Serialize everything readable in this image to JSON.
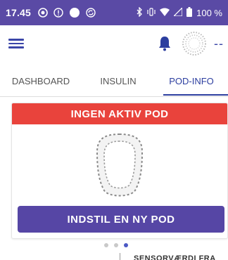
{
  "status_bar": {
    "time": "17.45",
    "battery_label": "100 %",
    "icons": [
      "circle-dot-icon",
      "info-circle-icon",
      "solid-circle-icon",
      "sync-icon",
      "bluetooth-icon",
      "vibrate-icon",
      "wifi-icon",
      "signal-icon",
      "battery-icon"
    ]
  },
  "app_bar": {
    "menu_icon": "hamburger-menu-icon",
    "bell_icon": "bell-icon",
    "status_indicator_icon": "dotted-circle-icon",
    "status_text": "--"
  },
  "tabs": [
    {
      "label": "DASHBOARD",
      "active": false
    },
    {
      "label": "INSULIN",
      "active": false
    },
    {
      "label": "POD-INFO",
      "active": true
    }
  ],
  "pod_card": {
    "banner_text": "INGEN AKTIV POD",
    "banner_color": "#e9433c",
    "button_label": "INDSTIL EN NY POD",
    "button_color": "#5646a5"
  },
  "pager": {
    "count": 3,
    "active_index": 2
  },
  "next_card_peek": "SENSORVÆRDI FRA"
}
